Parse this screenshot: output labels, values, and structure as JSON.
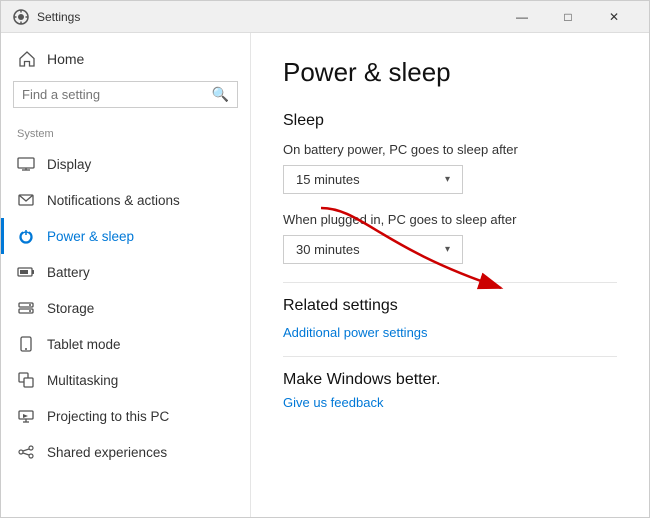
{
  "titlebar": {
    "title": "Settings",
    "icon": "⚙",
    "minimize": "—",
    "maximize": "□",
    "close": "✕"
  },
  "sidebar": {
    "home_label": "Home",
    "search_placeholder": "Find a setting",
    "section_label": "System",
    "items": [
      {
        "id": "display",
        "label": "Display",
        "icon": "display"
      },
      {
        "id": "notifications",
        "label": "Notifications & actions",
        "icon": "notifications"
      },
      {
        "id": "power",
        "label": "Power & sleep",
        "icon": "power",
        "active": true
      },
      {
        "id": "battery",
        "label": "Battery",
        "icon": "battery"
      },
      {
        "id": "storage",
        "label": "Storage",
        "icon": "storage"
      },
      {
        "id": "tablet",
        "label": "Tablet mode",
        "icon": "tablet"
      },
      {
        "id": "multitasking",
        "label": "Multitasking",
        "icon": "multitasking"
      },
      {
        "id": "projecting",
        "label": "Projecting to this PC",
        "icon": "projecting"
      },
      {
        "id": "shared",
        "label": "Shared experiences",
        "icon": "shared"
      }
    ]
  },
  "main": {
    "page_title": "Power & sleep",
    "sleep_section_title": "Sleep",
    "battery_sleep_label": "On battery power, PC goes to sleep after",
    "battery_sleep_value": "15 minutes",
    "plugged_sleep_label": "When plugged in, PC goes to sleep after",
    "plugged_sleep_value": "30 minutes",
    "related_settings_title": "Related settings",
    "additional_power_link": "Additional power settings",
    "make_windows_title": "Make Windows better.",
    "feedback_link": "Give us feedback"
  }
}
